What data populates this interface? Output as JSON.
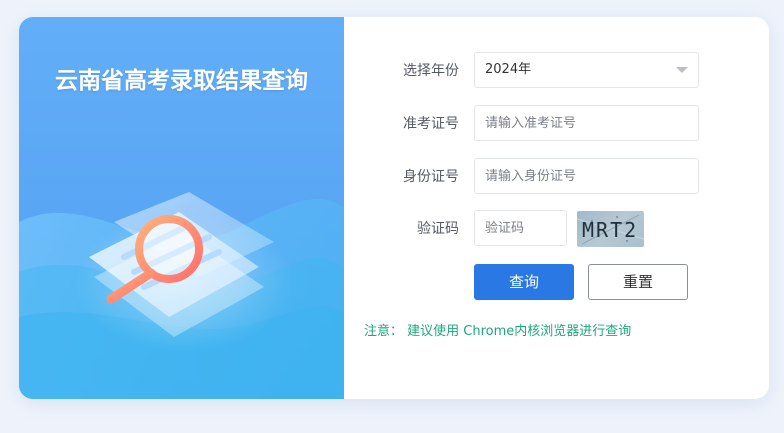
{
  "title": "云南省高考录取结果查询",
  "form": {
    "year": {
      "label": "选择年份",
      "value": "2024年"
    },
    "ticket": {
      "label": "准考证号",
      "placeholder": "请输入准考证号"
    },
    "id": {
      "label": "身份证号",
      "placeholder": "请输入身份证号"
    },
    "captcha": {
      "label": "验证码",
      "placeholder": "验证码",
      "image_text": "MRT2"
    }
  },
  "buttons": {
    "query": "查询",
    "reset": "重置"
  },
  "notice": {
    "prefix": "注意：",
    "text": "建议使用 Chrome内核浏览器进行查询"
  },
  "colors": {
    "primary": "#2a78e4",
    "notice": "#1ea77e",
    "banner": "#5aa7f5"
  }
}
